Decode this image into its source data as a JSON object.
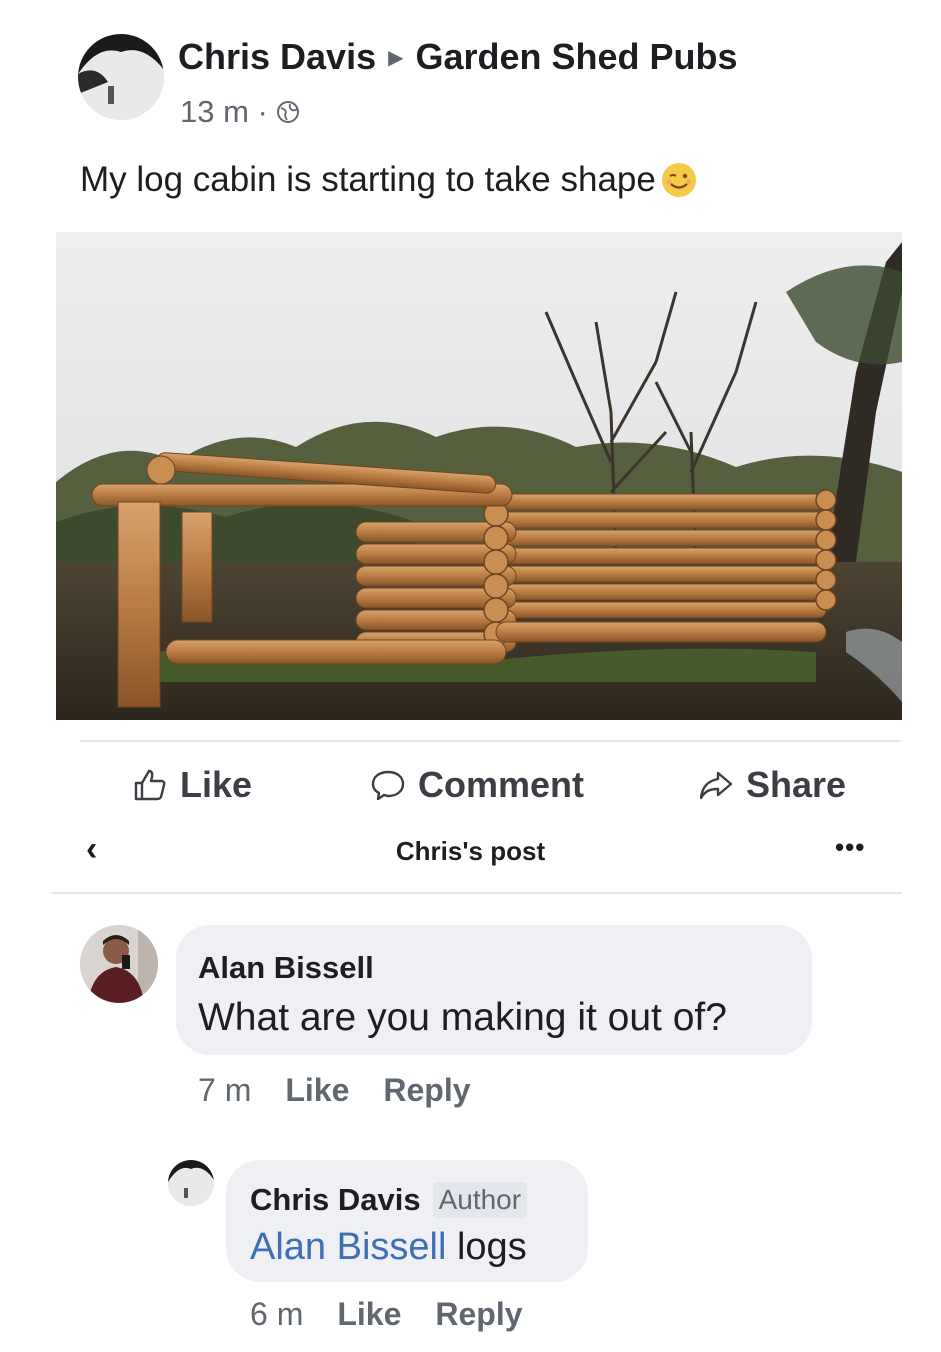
{
  "post": {
    "author": "Chris Davis",
    "group": "Garden Shed Pubs",
    "time": "13 m ·",
    "text": "My log cabin is starting to take shape"
  },
  "actions": {
    "like": "Like",
    "comment": "Comment",
    "share": "Share"
  },
  "header": {
    "back_icon": "‹",
    "title": "Chris's post",
    "more": "•••"
  },
  "comments": [
    {
      "name": "Alan Bissell",
      "text": "What are you making it out of?",
      "time": "7 m",
      "like": "Like",
      "reply": "Reply"
    },
    {
      "name": "Chris Davis",
      "badge": "Author",
      "mention": "Alan Bissell",
      "text": " logs",
      "time": "6 m",
      "like": "Like",
      "reply": "Reply"
    }
  ],
  "colors": {
    "accent": "#3f6eb5",
    "bubble": "#eef0f3",
    "meta": "#606770"
  },
  "icons": [
    "globe-icon",
    "wink-emoji-icon",
    "like-thumb-icon",
    "comment-bubble-icon",
    "share-arrow-icon",
    "back-chevron-icon",
    "more-dots-icon"
  ]
}
